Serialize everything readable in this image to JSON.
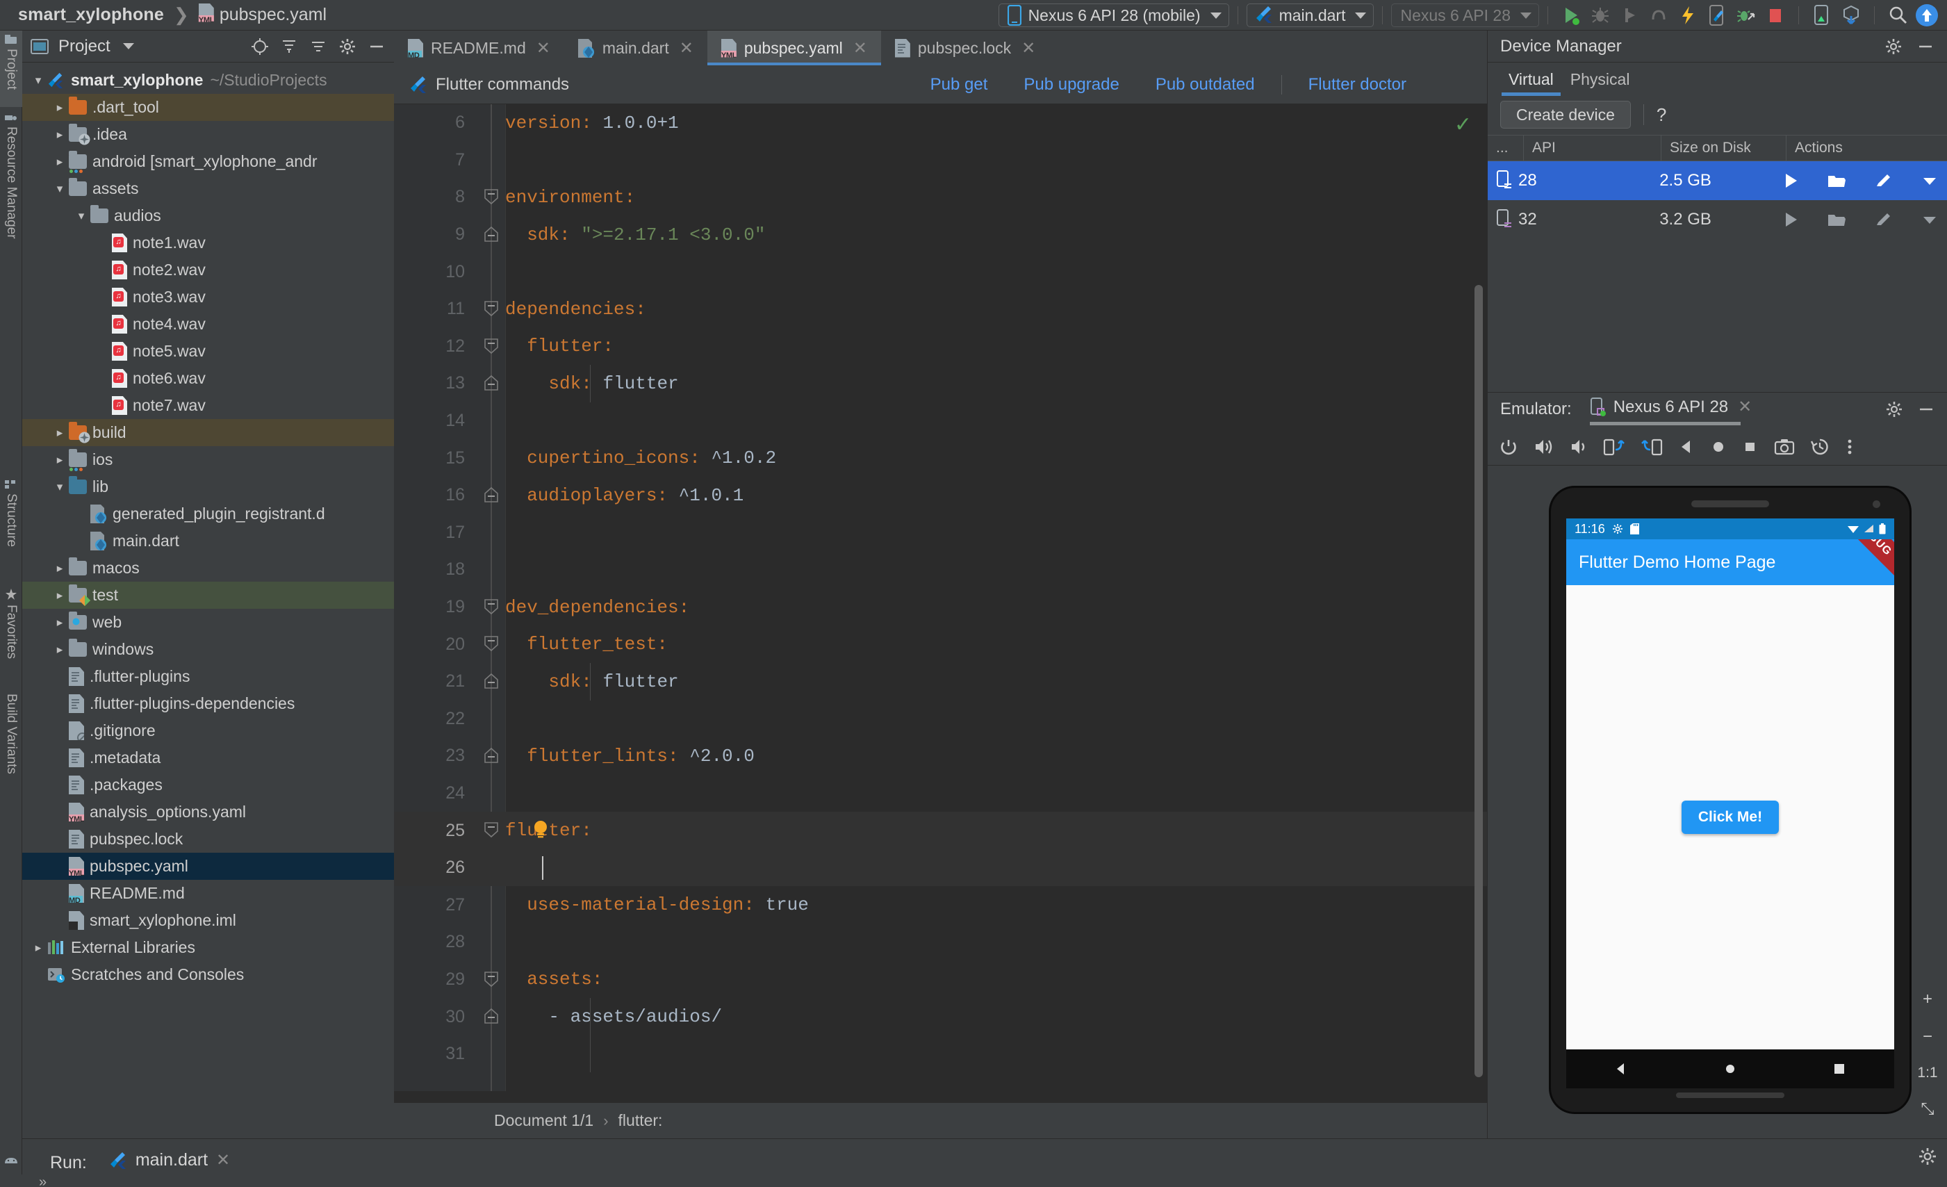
{
  "breadcrumb": {
    "project": "smart_xylophone",
    "file": "pubspec.yaml"
  },
  "toolbar": {
    "device_selector": "Nexus 6 API 28 (mobile)",
    "run_config": "main.dart",
    "device_secondary": "Nexus 6 API 28",
    "icons": [
      "run-icon",
      "debug-icon",
      "profile-icon",
      "coverage-icon",
      "hot-reload-icon",
      "flutter-device-icon",
      "attach-debugger-icon",
      "stop-icon",
      "flutter-inspector-icon",
      "device-file-explorer-icon",
      "search-icon",
      "avatar-icon"
    ]
  },
  "left_strip": {
    "items": [
      {
        "label": "Project",
        "selected": true
      },
      {
        "label": "Resource Manager",
        "selected": false
      },
      {
        "label": "Structure",
        "selected": false
      },
      {
        "label": "Favorites",
        "selected": false
      },
      {
        "label": "Build Variants",
        "selected": false
      }
    ]
  },
  "project_panel": {
    "title": "Project",
    "tree": [
      {
        "depth": 0,
        "arrow": "down",
        "icon": "flutter",
        "label": "smart_xylophone",
        "suffix": "~/StudioProjects",
        "bold": true,
        "sel": "none"
      },
      {
        "depth": 1,
        "arrow": "right",
        "icon": "folder-orange",
        "label": ".dart_tool",
        "sel": "olive"
      },
      {
        "depth": 1,
        "arrow": "right",
        "icon": "folder-idea",
        "label": ".idea",
        "sel": "none"
      },
      {
        "depth": 1,
        "arrow": "right",
        "icon": "folder-module",
        "label": "android [smart_xylophone_andr",
        "bolditalic": true,
        "sel": "none"
      },
      {
        "depth": 1,
        "arrow": "down",
        "icon": "folder",
        "label": "assets",
        "sel": "none"
      },
      {
        "depth": 2,
        "arrow": "down",
        "icon": "folder",
        "label": "audios",
        "sel": "none"
      },
      {
        "depth": 3,
        "arrow": "none",
        "icon": "wav",
        "label": "note1.wav",
        "sel": "none"
      },
      {
        "depth": 3,
        "arrow": "none",
        "icon": "wav",
        "label": "note2.wav",
        "sel": "none"
      },
      {
        "depth": 3,
        "arrow": "none",
        "icon": "wav",
        "label": "note3.wav",
        "sel": "none"
      },
      {
        "depth": 3,
        "arrow": "none",
        "icon": "wav",
        "label": "note4.wav",
        "sel": "none"
      },
      {
        "depth": 3,
        "arrow": "none",
        "icon": "wav",
        "label": "note5.wav",
        "sel": "none"
      },
      {
        "depth": 3,
        "arrow": "none",
        "icon": "wav",
        "label": "note6.wav",
        "sel": "none"
      },
      {
        "depth": 3,
        "arrow": "none",
        "icon": "wav",
        "label": "note7.wav",
        "sel": "none"
      },
      {
        "depth": 1,
        "arrow": "right",
        "icon": "folder-build",
        "label": "build",
        "sel": "olive"
      },
      {
        "depth": 1,
        "arrow": "right",
        "icon": "folder-module",
        "label": "ios",
        "sel": "none"
      },
      {
        "depth": 1,
        "arrow": "down",
        "icon": "folder-blue",
        "label": "lib",
        "sel": "none"
      },
      {
        "depth": 2,
        "arrow": "none",
        "icon": "dart",
        "label": "generated_plugin_registrant.d",
        "sel": "none"
      },
      {
        "depth": 2,
        "arrow": "none",
        "icon": "dart",
        "label": "main.dart",
        "sel": "none"
      },
      {
        "depth": 1,
        "arrow": "right",
        "icon": "folder",
        "label": "macos",
        "sel": "none"
      },
      {
        "depth": 1,
        "arrow": "right",
        "icon": "folder-test",
        "label": "test",
        "sel": "green"
      },
      {
        "depth": 1,
        "arrow": "right",
        "icon": "folder-web",
        "label": "web",
        "sel": "none"
      },
      {
        "depth": 1,
        "arrow": "right",
        "icon": "folder",
        "label": "windows",
        "sel": "none"
      },
      {
        "depth": 1,
        "arrow": "none",
        "icon": "txt",
        "label": ".flutter-plugins",
        "sel": "none"
      },
      {
        "depth": 1,
        "arrow": "none",
        "icon": "txt",
        "label": ".flutter-plugins-dependencies",
        "sel": "none"
      },
      {
        "depth": 1,
        "arrow": "none",
        "icon": "gitignore",
        "label": ".gitignore",
        "sel": "none"
      },
      {
        "depth": 1,
        "arrow": "none",
        "icon": "txt",
        "label": ".metadata",
        "sel": "none"
      },
      {
        "depth": 1,
        "arrow": "none",
        "icon": "txt",
        "label": ".packages",
        "sel": "none"
      },
      {
        "depth": 1,
        "arrow": "none",
        "icon": "yml",
        "label": "analysis_options.yaml",
        "sel": "none"
      },
      {
        "depth": 1,
        "arrow": "none",
        "icon": "txt",
        "label": "pubspec.lock",
        "sel": "none"
      },
      {
        "depth": 1,
        "arrow": "none",
        "icon": "yml",
        "label": "pubspec.yaml",
        "sel": "blue"
      },
      {
        "depth": 1,
        "arrow": "none",
        "icon": "md",
        "label": "README.md",
        "sel": "none"
      },
      {
        "depth": 1,
        "arrow": "none",
        "icon": "iml",
        "label": "smart_xylophone.iml",
        "sel": "none"
      },
      {
        "depth": 0,
        "arrow": "right",
        "icon": "libs",
        "label": "External Libraries",
        "sel": "none"
      },
      {
        "depth": 0,
        "arrow": "none",
        "icon": "scratch",
        "label": "Scratches and Consoles",
        "sel": "none"
      }
    ]
  },
  "editor": {
    "tabs": [
      {
        "label": "README.md",
        "icon": "md",
        "active": false
      },
      {
        "label": "main.dart",
        "icon": "dart",
        "active": false
      },
      {
        "label": "pubspec.yaml",
        "icon": "yml",
        "active": true
      },
      {
        "label": "pubspec.lock",
        "icon": "txt",
        "active": false
      }
    ],
    "command_bar": {
      "label": "Flutter commands",
      "links": [
        "Pub get",
        "Pub upgrade",
        "Pub outdated",
        "Flutter doctor"
      ]
    },
    "lines": [
      {
        "n": 6,
        "segments": [
          {
            "t": "version: ",
            "c": "k"
          },
          {
            "t": "1.0.0+1",
            "c": "v"
          }
        ],
        "indent": 0
      },
      {
        "n": 7,
        "segments": [],
        "indent": 0
      },
      {
        "n": 8,
        "segments": [
          {
            "t": "environment:",
            "c": "k"
          }
        ],
        "indent": 0,
        "fold": "minus-top"
      },
      {
        "n": 9,
        "segments": [
          {
            "t": "  sdk: ",
            "c": "k"
          },
          {
            "t": "\">=2.17.1 <3.0.0\"",
            "c": "s"
          }
        ],
        "indent": 0,
        "fold": "minus-end"
      },
      {
        "n": 10,
        "segments": [],
        "indent": 0
      },
      {
        "n": 11,
        "segments": [
          {
            "t": "dependencies:",
            "c": "k"
          }
        ],
        "indent": 0,
        "fold": "minus-top"
      },
      {
        "n": 12,
        "segments": [
          {
            "t": "  flutter:",
            "c": "k"
          }
        ],
        "indent": 0,
        "fold": "minus-top"
      },
      {
        "n": 13,
        "segments": [
          {
            "t": "    sdk: ",
            "c": "k"
          },
          {
            "t": "flutter",
            "c": "v"
          }
        ],
        "indent": 1,
        "fold": "minus-end"
      },
      {
        "n": 14,
        "segments": [],
        "indent": 0
      },
      {
        "n": 15,
        "segments": [
          {
            "t": "  cupertino_icons: ",
            "c": "k"
          },
          {
            "t": "^1.0.2",
            "c": "v"
          }
        ],
        "indent": 0
      },
      {
        "n": 16,
        "segments": [
          {
            "t": "  audioplayers: ",
            "c": "k"
          },
          {
            "t": "^1.0.1",
            "c": "v"
          }
        ],
        "indent": 0,
        "fold": "minus-end"
      },
      {
        "n": 17,
        "segments": [],
        "indent": 0
      },
      {
        "n": 18,
        "segments": [],
        "indent": 0
      },
      {
        "n": 19,
        "segments": [
          {
            "t": "dev_dependencies:",
            "c": "k"
          }
        ],
        "indent": 0,
        "fold": "minus-top"
      },
      {
        "n": 20,
        "segments": [
          {
            "t": "  flutter_test:",
            "c": "k"
          }
        ],
        "indent": 0,
        "fold": "minus-top"
      },
      {
        "n": 21,
        "segments": [
          {
            "t": "    sdk: ",
            "c": "k"
          },
          {
            "t": "flutter",
            "c": "v"
          }
        ],
        "indent": 1,
        "fold": "minus-end"
      },
      {
        "n": 22,
        "segments": [],
        "indent": 0
      },
      {
        "n": 23,
        "segments": [
          {
            "t": "  flutter_lints: ",
            "c": "k"
          },
          {
            "t": "^2.0.0",
            "c": "v"
          }
        ],
        "indent": 0,
        "fold": "minus-end"
      },
      {
        "n": 24,
        "segments": [],
        "indent": 0
      },
      {
        "n": 25,
        "segments": [
          {
            "t": "flutter:",
            "c": "k"
          }
        ],
        "indent": 0,
        "fold": "minus-top",
        "bulb": true,
        "current": true
      },
      {
        "n": 26,
        "segments": [],
        "indent": 0,
        "caret": true
      },
      {
        "n": 27,
        "segments": [
          {
            "t": "  uses-material-design: ",
            "c": "k"
          },
          {
            "t": "true",
            "c": "v"
          }
        ],
        "indent": 0
      },
      {
        "n": 28,
        "segments": [],
        "indent": 0
      },
      {
        "n": 29,
        "segments": [
          {
            "t": "  assets:",
            "c": "k"
          }
        ],
        "indent": 0,
        "fold": "minus-top"
      },
      {
        "n": 30,
        "segments": [
          {
            "t": "    - assets/audios/",
            "c": "v"
          }
        ],
        "indent": 1,
        "fold": "minus-end"
      },
      {
        "n": 31,
        "segments": [],
        "indent": 1
      }
    ],
    "status": {
      "document": "Document 1/1",
      "separator": "›",
      "context": "flutter:"
    }
  },
  "device_manager": {
    "title": "Device Manager",
    "tabs": [
      {
        "label": "Virtual",
        "active": true
      },
      {
        "label": "Physical",
        "active": false
      }
    ],
    "create_button": "Create device",
    "help": "?",
    "columns": [
      "...",
      "API",
      "Size on Disk",
      "Actions"
    ],
    "rows": [
      {
        "api": "28",
        "size": "2.5 GB",
        "selected": true,
        "actions": [
          "play-icon",
          "folder-icon",
          "edit-icon",
          "chevron-down-icon"
        ]
      },
      {
        "api": "32",
        "size": "3.2 GB",
        "selected": false,
        "actions": [
          "play-icon",
          "folder-icon",
          "edit-icon",
          "chevron-down-icon"
        ]
      }
    ]
  },
  "emulator": {
    "label": "Emulator:",
    "tab_name": "Nexus 6 API 28",
    "toolbar_icons": [
      "power-icon",
      "volume-up-icon",
      "volume-down-icon",
      "rotate-left-icon",
      "rotate-right-icon",
      "back-icon",
      "home-icon",
      "overview-icon",
      "screenshot-icon",
      "history-icon",
      "more-icon"
    ],
    "zoom_tools": [
      "zoom-in-icon",
      "zoom-out-icon",
      "actual-size-icon",
      "fit-screen-icon"
    ],
    "zoom_labels": {
      "actual": "1:1",
      "fit": "⤡"
    },
    "screen": {
      "status_time": "11:16",
      "status_icons": [
        "gear-icon",
        "sdcard-icon",
        "wifi-icon",
        "signal-icon",
        "battery-icon"
      ],
      "app_title": "Flutter Demo Home Page",
      "debug_banner": "DEBUG",
      "button_label": "Click Me!"
    }
  },
  "run_panel": {
    "label": "Run:",
    "tab": "main.dart"
  }
}
